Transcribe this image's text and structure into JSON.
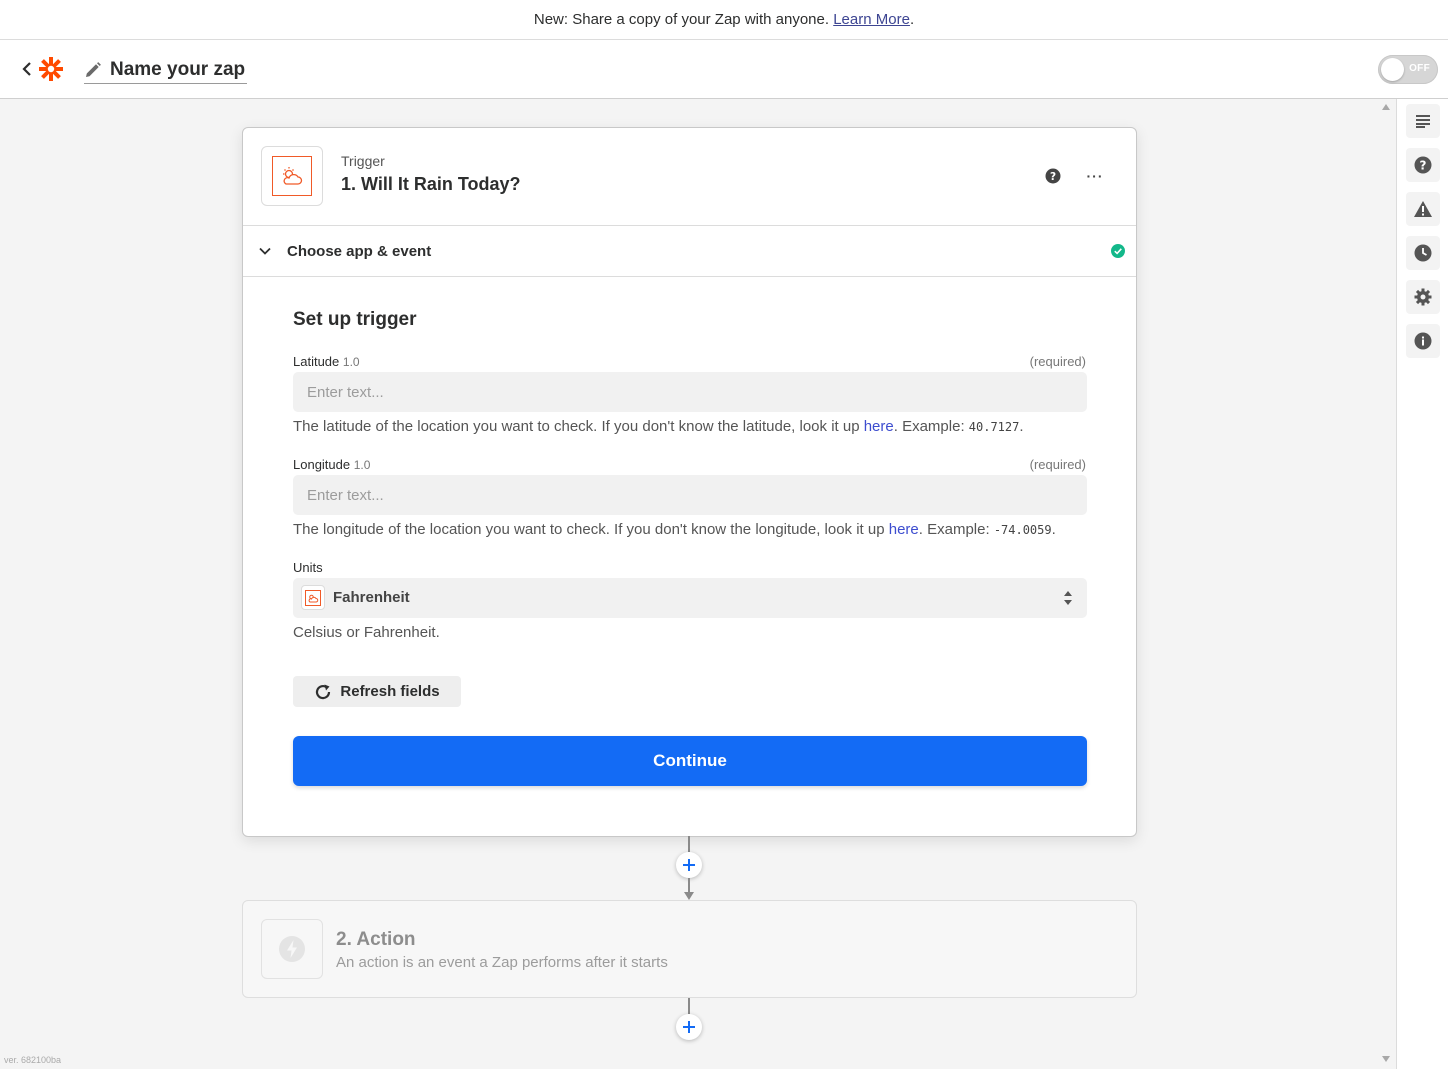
{
  "banner": {
    "text": "New: Share a copy of your Zap with anyone.",
    "link": "Learn More",
    "suffix": "."
  },
  "header": {
    "zap_name": "Name your zap",
    "toggle_label": "OFF"
  },
  "trigger": {
    "kind": "Trigger",
    "name": "1. Will It Rain Today?",
    "more_label": "···",
    "section_label": "Choose app & event"
  },
  "setup": {
    "title": "Set up trigger",
    "latitude": {
      "label": "Latitude",
      "version": "1.0",
      "required": "(required)",
      "placeholder": "Enter text...",
      "help_before": "The latitude of the location you want to check. If you don't know the latitude, look it up ",
      "help_link": "here",
      "help_after": ". Example: ",
      "example": "40.7127",
      "end": "."
    },
    "longitude": {
      "label": "Longitude",
      "version": "1.0",
      "required": "(required)",
      "placeholder": "Enter text...",
      "help_before": "The longitude of the location you want to check. If you don't know the longitude, look it up ",
      "help_link": "here",
      "help_after": ". Example: ",
      "example": "-74.0059",
      "end": "."
    },
    "units": {
      "label": "Units",
      "value": "Fahrenheit",
      "help": "Celsius or Fahrenheit."
    },
    "refresh_label": "Refresh fields",
    "continue_label": "Continue"
  },
  "action": {
    "title": "2. Action",
    "subtitle": "An action is an event a Zap performs after it starts"
  },
  "version": "ver. 682100ba",
  "colors": {
    "accent": "#136bf5",
    "brand": "#ff4a00",
    "success": "#13b88a"
  }
}
